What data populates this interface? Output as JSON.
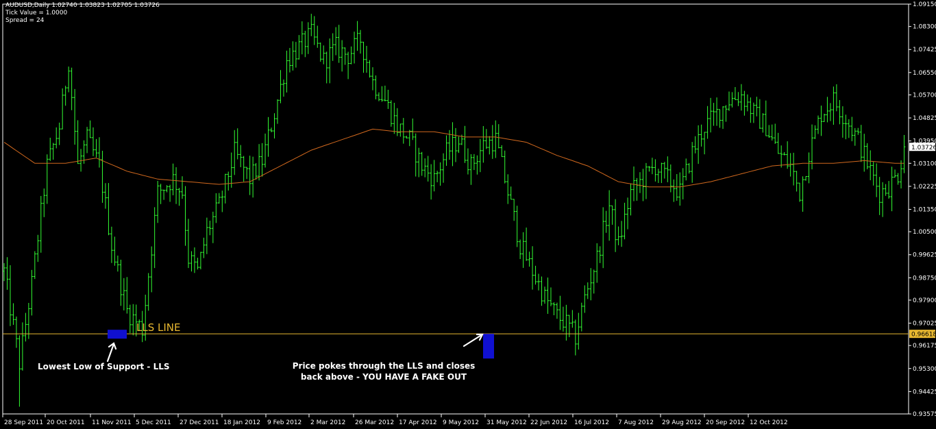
{
  "header": {
    "symbol_line": "AUDUSD,Daily  1.02740 1.03823 1.02705 1.03726",
    "tick_value": "Tick Value = 1.0000",
    "spread": "Spread = 24"
  },
  "annotations": {
    "lls_line_label": "LLS LINE",
    "lowest_low": "Lowest Low of Support - LLS",
    "fakeout_line1": "Price pokes through the LLS and closes",
    "fakeout_line2": "back above - YOU HAVE A FAKE OUT"
  },
  "colors": {
    "background": "#000000",
    "bar": "#33ff33",
    "moving_average": "#d2691e",
    "lls_line": "#e8b830",
    "highlight": "#1010d0",
    "price_tag_current": "#ffffff",
    "price_tag_lls": "#e8b830"
  },
  "chart_data": {
    "type": "bar",
    "subtype": "ohlc",
    "symbol": "AUDUSD",
    "timeframe": "Daily",
    "ylim": [
      0.93575,
      1.0915
    ],
    "yticks": [
      "1.09150",
      "1.08300",
      "1.07425",
      "1.06550",
      "1.05700",
      "1.04825",
      "1.03950",
      "1.03100",
      "1.02225",
      "1.01350",
      "1.00500",
      "0.99625",
      "0.98750",
      "0.97900",
      "0.97025",
      "0.96175",
      "0.95300",
      "0.94425",
      "0.93575"
    ],
    "xticks": [
      "28 Sep 2011",
      "20 Oct 2011",
      "11 Nov 2011",
      "5 Dec 2011",
      "27 Dec 2011",
      "18 Jan 2012",
      "9 Feb 2012",
      "2 Mar 2012",
      "26 Mar 2012",
      "17 Apr 2012",
      "9 May 2012",
      "31 May 2012",
      "22 Jun 2012",
      "16 Jul 2012",
      "7 Aug 2012",
      "29 Aug 2012",
      "20 Sep 2012",
      "12 Oct 2012"
    ],
    "current_price": "1.03726",
    "lls_price": "0.96618",
    "lls_value": 0.96618,
    "current_value": 1.03726,
    "close_path": [
      [
        0,
        0.99
      ],
      [
        5,
        0.955
      ],
      [
        9,
        0.985
      ],
      [
        14,
        1.03
      ],
      [
        18,
        1.045
      ],
      [
        21,
        1.07
      ],
      [
        24,
        1.03
      ],
      [
        27,
        1.04
      ],
      [
        31,
        1.03
      ],
      [
        35,
        1.0
      ],
      [
        40,
        0.975
      ],
      [
        45,
        0.968
      ],
      [
        50,
        1.02
      ],
      [
        55,
        1.025
      ],
      [
        58,
        1.02
      ],
      [
        60,
        0.995
      ],
      [
        63,
        0.99
      ],
      [
        66,
        1.005
      ],
      [
        70,
        1.015
      ],
      [
        75,
        1.035
      ],
      [
        80,
        1.025
      ],
      [
        84,
        1.032
      ],
      [
        88,
        1.05
      ],
      [
        92,
        1.07
      ],
      [
        96,
        1.075
      ],
      [
        100,
        1.08
      ],
      [
        104,
        1.07
      ],
      [
        108,
        1.075
      ],
      [
        112,
        1.072
      ],
      [
        116,
        1.078
      ],
      [
        120,
        1.062
      ],
      [
        124,
        1.055
      ],
      [
        128,
        1.045
      ],
      [
        132,
        1.04
      ],
      [
        136,
        1.03
      ],
      [
        140,
        1.025
      ],
      [
        144,
        1.035
      ],
      [
        148,
        1.04
      ],
      [
        152,
        1.03
      ],
      [
        156,
        1.038
      ],
      [
        160,
        1.04
      ],
      [
        164,
        1.02
      ],
      [
        168,
        1.0
      ],
      [
        172,
        0.99
      ],
      [
        176,
        0.98
      ],
      [
        180,
        0.973
      ],
      [
        183,
        0.97
      ],
      [
        186,
        0.965
      ],
      [
        189,
        0.98
      ],
      [
        193,
        0.995
      ],
      [
        197,
        1.015
      ],
      [
        200,
        1.0
      ],
      [
        204,
        1.02
      ],
      [
        208,
        1.025
      ],
      [
        212,
        1.03
      ],
      [
        216,
        1.025
      ],
      [
        220,
        1.02
      ],
      [
        224,
        1.035
      ],
      [
        228,
        1.045
      ],
      [
        232,
        1.05
      ],
      [
        236,
        1.055
      ],
      [
        240,
        1.057
      ],
      [
        244,
        1.05
      ],
      [
        248,
        1.045
      ],
      [
        252,
        1.035
      ],
      [
        256,
        1.03
      ],
      [
        259,
        1.02
      ],
      [
        262,
        1.035
      ],
      [
        266,
        1.05
      ],
      [
        270,
        1.055
      ],
      [
        274,
        1.048
      ],
      [
        278,
        1.04
      ],
      [
        282,
        1.028
      ],
      [
        285,
        1.02
      ],
      [
        288,
        1.022
      ],
      [
        291,
        1.027
      ],
      [
        293,
        1.037
      ]
    ],
    "ma_path": [
      [
        0,
        1.039
      ],
      [
        10,
        1.031
      ],
      [
        20,
        1.031
      ],
      [
        30,
        1.033
      ],
      [
        40,
        1.028
      ],
      [
        50,
        1.025
      ],
      [
        60,
        1.024
      ],
      [
        70,
        1.023
      ],
      [
        80,
        1.024
      ],
      [
        90,
        1.03
      ],
      [
        100,
        1.036
      ],
      [
        110,
        1.04
      ],
      [
        120,
        1.044
      ],
      [
        128,
        1.043
      ],
      [
        140,
        1.043
      ],
      [
        150,
        1.041
      ],
      [
        160,
        1.041
      ],
      [
        170,
        1.039
      ],
      [
        180,
        1.034
      ],
      [
        190,
        1.03
      ],
      [
        200,
        1.024
      ],
      [
        210,
        1.022
      ],
      [
        220,
        1.022
      ],
      [
        230,
        1.024
      ],
      [
        240,
        1.027
      ],
      [
        250,
        1.03
      ],
      [
        260,
        1.031
      ],
      [
        270,
        1.031
      ],
      [
        280,
        1.032
      ],
      [
        290,
        1.031
      ],
      [
        293,
        1.031
      ]
    ]
  }
}
